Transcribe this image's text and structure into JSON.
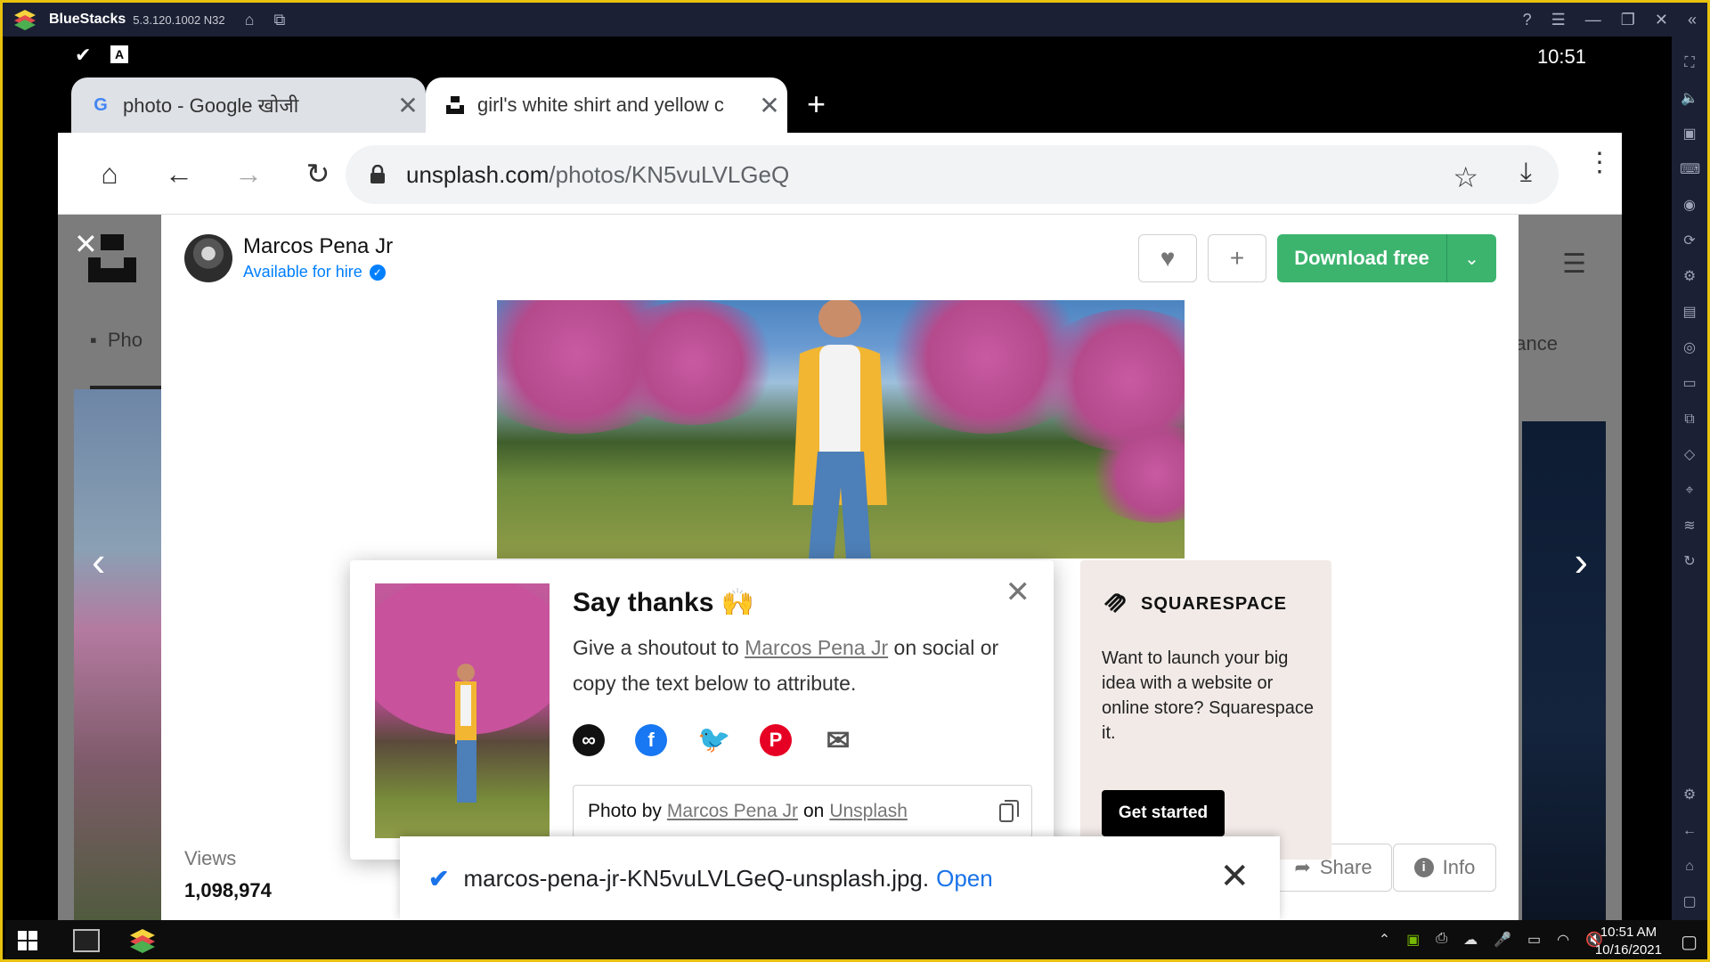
{
  "emulator": {
    "app_name": "BlueStacks",
    "version": "5.3.120.1002 N32",
    "sidebar_icons": [
      "fullscreen-icon",
      "volume-icon",
      "media-icon",
      "keyboard-icon",
      "record-icon",
      "rotate-icon",
      "macro-icon",
      "apk-icon",
      "screenshot-icon",
      "folder-icon",
      "multi-instance-icon",
      "eco-icon",
      "location-icon",
      "layers-icon",
      "sync-icon",
      "settings-icon",
      "back-icon",
      "home-icon",
      "recents-icon"
    ]
  },
  "android_status": {
    "clock": "10:51",
    "notif_icon_2": "A"
  },
  "browser": {
    "tabs": [
      {
        "favicon": "G",
        "title": "photo - Google खोजी"
      },
      {
        "favicon": "U",
        "title": "girl's white shirt and yellow c"
      }
    ],
    "url_host": "unsplash.com",
    "url_path": "/photos/KN5vuLVLGeQ"
  },
  "page_bg": {
    "left_tab_label": "Pho",
    "right_tab_label": "ance"
  },
  "modal": {
    "author_name": "Marcos Pena Jr",
    "hire_text": "Available for hire",
    "download_label": "Download free",
    "views_label": "Views",
    "views_value": "1,098,974",
    "share_label": "Share",
    "info_label": "Info"
  },
  "thanks_popup": {
    "title": "Say thanks 🙌",
    "text_before": "Give a shoutout to",
    "author_link": "Marcos Pena Jr",
    "text_after": "on social or copy the text below to attribute.",
    "attr_prefix": "Photo by",
    "attr_author": "Marcos Pena Jr",
    "attr_on": "on",
    "attr_site": "Unsplash",
    "social_icons": [
      "link-icon",
      "facebook-icon",
      "twitter-icon",
      "pinterest-icon",
      "mail-icon"
    ]
  },
  "ad": {
    "brand": "SQUARESPACE",
    "text": "Want to launch your big idea with a website or online store? Squarespace it.",
    "cta": "Get started"
  },
  "download_bar": {
    "filename": "marcos-pena-jr-KN5vuLVLGeQ-unsplash.jpg.",
    "action": "Open"
  },
  "taskbar": {
    "time": "10:51 AM",
    "date": "10/16/2021"
  },
  "colors": {
    "download_green": "#3cb46e",
    "link_blue": "#1a73e8",
    "unsplash_blue": "#007fff",
    "bluestacks_frame": "#e8c20e"
  }
}
